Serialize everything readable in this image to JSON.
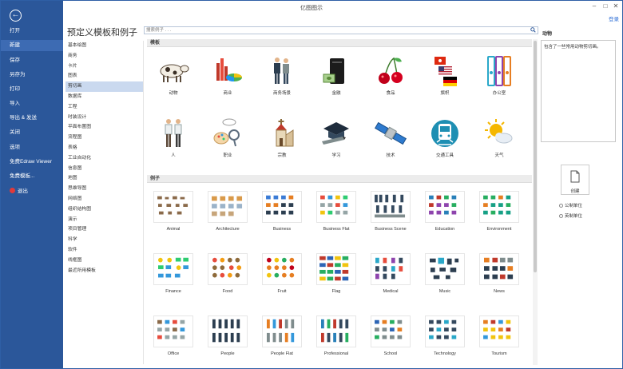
{
  "window": {
    "title": "亿图图示",
    "login": "登录"
  },
  "sidebar": {
    "items": [
      {
        "label": "打开"
      },
      {
        "label": "新建",
        "selected": true
      },
      {
        "label": "保存"
      },
      {
        "label": "另存为"
      },
      {
        "label": "打印"
      },
      {
        "label": "导入"
      },
      {
        "label": "导出 & 发送"
      },
      {
        "label": "关闭"
      },
      {
        "label": "选项"
      },
      {
        "label": "免费Edraw Viewer"
      },
      {
        "label": "免费模板..."
      },
      {
        "label": "退出"
      }
    ]
  },
  "main": {
    "title": "预定义模板和例子",
    "search_placeholder": "搜索例子 . . .",
    "categories": [
      "基本绘图",
      "商务",
      "卡片",
      "图表",
      "剪切画",
      "数据库",
      "工程",
      "时装设计",
      "平面布置图",
      "流程图",
      "表格",
      "工业自动化",
      "信息图",
      "地图",
      "思维导图",
      "网络图",
      "组织结构图",
      "演示",
      "项目管理",
      "科学",
      "软件",
      "线框图",
      "最近所用模板"
    ],
    "selected_category": "剪切画",
    "templates_header": "模板",
    "templates": [
      "动物",
      "商业",
      "商务场景",
      "金融",
      "食品",
      "旗帜",
      "办公室",
      "人",
      "职业",
      "宗教",
      "学习",
      "技术",
      "交通工具",
      "天气"
    ],
    "examples_header": "例子",
    "examples": [
      "Animal",
      "Architecture",
      "Business",
      "Business Flat",
      "Business Scene",
      "Education",
      "Environment",
      "Finance",
      "Food",
      "Fruit",
      "Flag",
      "Medical",
      "Music",
      "News",
      "Office",
      "People",
      "People Flat",
      "Professional",
      "School",
      "Technology",
      "Tourism"
    ]
  },
  "panel": {
    "title": "动物",
    "description": "包含了一些常用动物剪切画。",
    "create_label": "创建",
    "units": [
      {
        "label": "公制单位",
        "selected": false
      },
      {
        "label": "英制单位",
        "selected": false
      }
    ]
  }
}
